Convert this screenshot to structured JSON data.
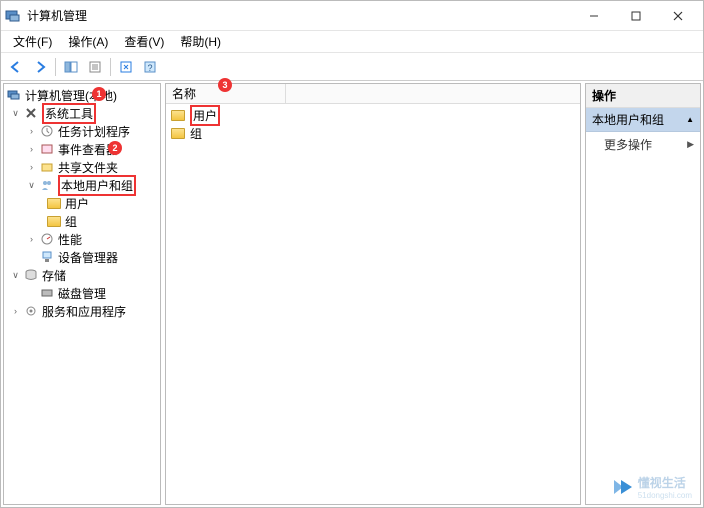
{
  "titlebar": {
    "title": "计算机管理"
  },
  "menubar": {
    "file": "文件(F)",
    "action": "操作(A)",
    "view": "查看(V)",
    "help": "帮助(H)"
  },
  "tree": {
    "root": "计算机管理(本地)",
    "system_tools": "系统工具",
    "task_scheduler": "任务计划程序",
    "event_viewer": "事件查看器",
    "shared_folders": "共享文件夹",
    "local_users_groups": "本地用户和组",
    "users": "用户",
    "groups": "组",
    "performance": "性能",
    "device_manager": "设备管理器",
    "storage": "存储",
    "disk_management": "磁盘管理",
    "services_apps": "服务和应用程序"
  },
  "list": {
    "header_name": "名称",
    "users": "用户",
    "groups": "组"
  },
  "actions": {
    "header": "操作",
    "section": "本地用户和组",
    "more": "更多操作"
  },
  "badges": {
    "b1": "1",
    "b2": "2",
    "b3": "3"
  },
  "watermark": {
    "name": "懂视生活",
    "domain": "51dongshi.com"
  }
}
